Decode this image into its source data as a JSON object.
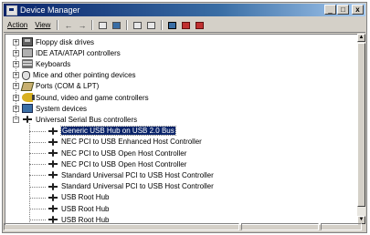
{
  "window": {
    "title": "Device Manager",
    "minimize": "_",
    "maximize": "□",
    "close": "x"
  },
  "menu": {
    "action": "Action",
    "view": "View"
  },
  "toolbar": {
    "back_icon": "arrow-left-icon",
    "forward_icon": "arrow-right-icon",
    "back_glyph": "←",
    "forward_glyph": "→"
  },
  "tree": {
    "categories": [
      {
        "label": "Floppy disk drives",
        "icon": "floppy-icon",
        "expander": "+"
      },
      {
        "label": "IDE ATA/ATAPI controllers",
        "icon": "ide-icon",
        "expander": "+"
      },
      {
        "label": "Keyboards",
        "icon": "keyboard-icon",
        "expander": "+"
      },
      {
        "label": "Mice and other pointing devices",
        "icon": "mouse-icon",
        "expander": "+"
      },
      {
        "label": "Ports (COM & LPT)",
        "icon": "ports-icon",
        "expander": "+"
      },
      {
        "label": "Sound, video and game controllers",
        "icon": "sound-icon",
        "expander": "+"
      },
      {
        "label": "System devices",
        "icon": "system-icon",
        "expander": "+"
      },
      {
        "label": "Universal Serial Bus controllers",
        "icon": "usb-icon",
        "expander": "−"
      }
    ],
    "usb_children": [
      {
        "label": "Generic USB Hub on USB 2.0 Bus",
        "selected": true
      },
      {
        "label": "NEC PCI to USB Enhanced Host Controller"
      },
      {
        "label": "NEC PCI to USB Open Host Controller"
      },
      {
        "label": "NEC PCI to USB Open Host Controller"
      },
      {
        "label": "Standard Universal PCI to USB Host Controller"
      },
      {
        "label": "Standard Universal PCI to USB Host Controller"
      },
      {
        "label": "USB Root Hub"
      },
      {
        "label": "USB Root Hub"
      },
      {
        "label": "USB Root Hub"
      }
    ]
  },
  "colors": {
    "selection": "#0a246a",
    "titlebar_start": "#0a246a",
    "window_bg": "#d4d0c8"
  }
}
